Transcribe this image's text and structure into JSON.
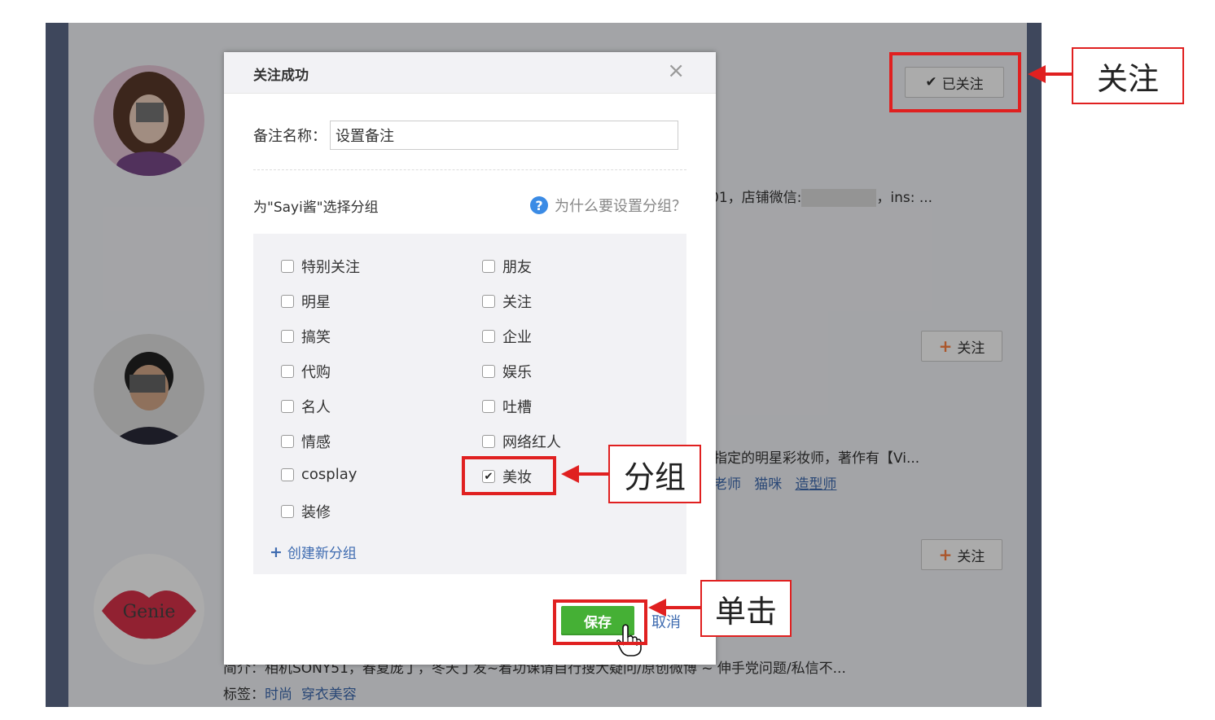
{
  "background_page": {
    "users": [
      {
        "follow_label": "已关注",
        "info_text": "01，店铺微信:",
        "info_tail": "，ins: ..."
      },
      {
        "follow_label": "关注",
        "info_text": "指定的明星彩妆师，著作有【Vi...",
        "tags": [
          "老师",
          "猫咪",
          "造型师"
        ]
      },
      {
        "follow_label": "关注",
        "bio": "简介：相机SONY51，春夏庞丁，冬天丁发~着功课请自行搜大疑问/原创微博 ~ 伸手党问题/私信不...",
        "tags_label": "标签：",
        "tags": [
          "时尚",
          "穿衣美容"
        ]
      }
    ],
    "logo_text": "Genie"
  },
  "dialog": {
    "title": "关注成功",
    "close_symbol": "×",
    "remark_label": "备注名称：",
    "remark_value": "设置备注",
    "group_title": "为\"Sayi酱\"选择分组",
    "why_label": "为什么要设置分组？",
    "why_icon_glyph": "?",
    "groups_left": [
      {
        "label": "特别关注",
        "checked": false
      },
      {
        "label": "明星",
        "checked": false
      },
      {
        "label": "搞笑",
        "checked": false
      },
      {
        "label": "代购",
        "checked": false
      },
      {
        "label": "名人",
        "checked": false
      },
      {
        "label": "情感",
        "checked": false
      },
      {
        "label": "cosplay",
        "checked": false
      },
      {
        "label": "装修",
        "checked": false
      }
    ],
    "groups_right": [
      {
        "label": "朋友",
        "checked": false
      },
      {
        "label": "关注",
        "checked": false
      },
      {
        "label": "企业",
        "checked": false
      },
      {
        "label": "娱乐",
        "checked": false
      },
      {
        "label": "吐槽",
        "checked": false
      },
      {
        "label": "网络红人",
        "checked": false
      },
      {
        "label": "美妆",
        "checked": true
      }
    ],
    "new_group_label": "创建新分组",
    "save_label": "保存",
    "cancel_label": "取消"
  },
  "annotations": {
    "follow_callout": "关注",
    "group_callout": "分组",
    "click_callout": "单击"
  },
  "colors": {
    "accent_green": "#45b035",
    "link_blue": "#3e6bb0",
    "annotation_red": "#e02020",
    "follow_plus_orange": "#ff8140"
  }
}
